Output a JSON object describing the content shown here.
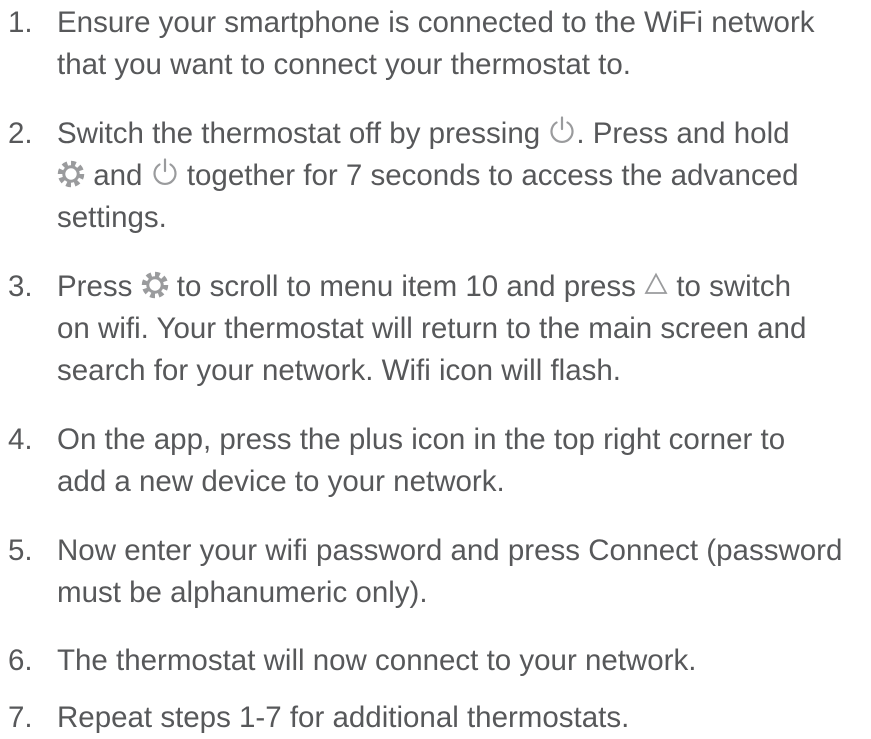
{
  "steps": [
    {
      "number": "1.",
      "lines": [
        "Ensure your smartphone is connected to the WiFi network",
        "that you want to connect your thermostat to."
      ]
    },
    {
      "number": "2.",
      "line1_a": "Switch the thermostat off by pressing ",
      "line1_b": ". Press and hold",
      "line2_a": " and ",
      "line2_b": " together for 7 seconds to access the advanced",
      "line3": "settings."
    },
    {
      "number": "3.",
      "line1_a": "Press ",
      "line1_b": " to scroll to menu item 10 and press ",
      "line1_c": " to switch",
      "line2": "on wifi. Your thermostat will return to the main screen and",
      "line3": "search for your network. Wifi icon will flash."
    },
    {
      "number": "4.",
      "lines": [
        "On the app, press the plus icon in the top right corner to",
        "add a new device to your network."
      ]
    },
    {
      "number": "5.",
      "lines": [
        "Now enter your wifi password and press Connect (password",
        "must be alphanumeric only)."
      ]
    },
    {
      "number": "6.",
      "lines": [
        "The thermostat will now connect to your network."
      ]
    },
    {
      "number": "7.",
      "lines": [
        "Repeat steps 1-7 for additional thermostats."
      ]
    }
  ],
  "icons": {
    "power": "power-icon",
    "settings": "settings-gear-icon",
    "up": "up-triangle-icon"
  },
  "colors": {
    "text": "#57585a",
    "icon": "#9a9b9d"
  }
}
